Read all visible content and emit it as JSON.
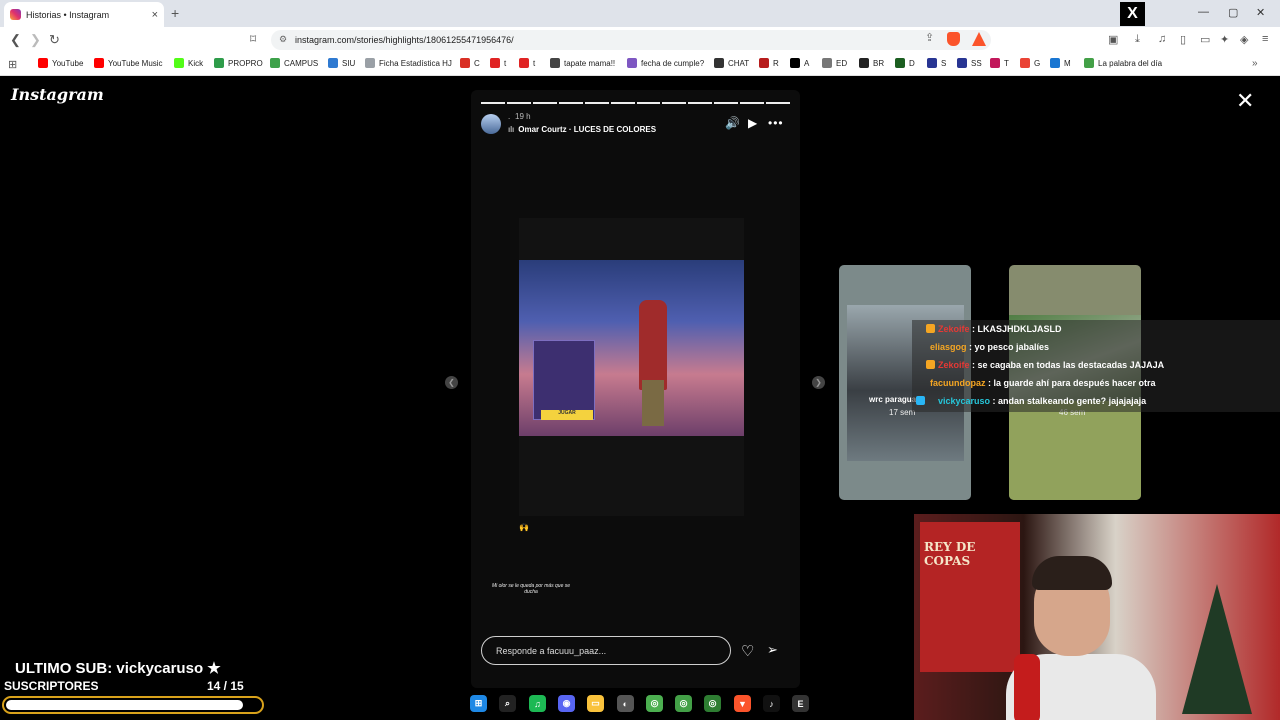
{
  "tab": {
    "title": "Historias • Instagram",
    "close": "×",
    "new_tab": "+"
  },
  "window": {
    "x_label": "X",
    "minimize": "—",
    "maximize": "▢",
    "close": "✕"
  },
  "toolbar": {
    "url": "instagram.com/stories/highlights/18061255471956476/",
    "back": "❮",
    "forward": "❯",
    "reload": "↻",
    "bookmark": "⌑"
  },
  "bookmarks": [
    {
      "label": "YouTube",
      "color": "#ff0000"
    },
    {
      "label": "YouTube Music",
      "color": "#ff0000"
    },
    {
      "label": "Kick",
      "color": "#53fc18"
    },
    {
      "label": "PROPRO",
      "color": "#2e9c4a"
    },
    {
      "label": "CAMPUS",
      "color": "#3da14a"
    },
    {
      "label": "SIU",
      "color": "#2f7ad1"
    },
    {
      "label": "Ficha Estadística HJ",
      "color": "#9aa0a6"
    },
    {
      "label": "C",
      "color": "#d93025"
    },
    {
      "label": "t",
      "color": "#e02424"
    },
    {
      "label": "t",
      "color": "#e02424"
    },
    {
      "label": "tapate mama!!",
      "color": "#444444"
    },
    {
      "label": "fecha de cumple?",
      "color": "#7e57c2"
    },
    {
      "label": "CHAT",
      "color": "#333333"
    },
    {
      "label": "R",
      "color": "#b71c1c"
    },
    {
      "label": "A",
      "color": "#000000"
    },
    {
      "label": "ED",
      "color": "#777777"
    },
    {
      "label": "BR",
      "color": "#222222"
    },
    {
      "label": "D",
      "color": "#1b5e20"
    },
    {
      "label": "S",
      "color": "#283593"
    },
    {
      "label": "SS",
      "color": "#283593"
    },
    {
      "label": "T",
      "color": "#c2185b"
    },
    {
      "label": "G",
      "color": "#ea4335"
    },
    {
      "label": "M",
      "color": "#1976d2"
    },
    {
      "label": "La palabra del día",
      "color": "#43a047"
    }
  ],
  "page": {
    "logo": "Instagram",
    "close": "✕",
    "story": {
      "dot": ".",
      "time": "19 h",
      "audio": "Omar Courtz · LUCES DE COLORES",
      "caption": "Mi olor se le queda por más que se ducha",
      "emoji": "🙌",
      "reply_placeholder": "Responde a facuuu_paaz...",
      "tv_play": "JUGAR"
    },
    "thumbs": [
      {
        "name": "wrc paraguay",
        "time": "17 sem"
      },
      {
        "name": "",
        "time": "46 sem"
      }
    ]
  },
  "chat": [
    {
      "user": "Zekoife",
      "text": " : LKASJHDKLJASLD",
      "color": "#e53935",
      "badge": "#f5a623"
    },
    {
      "user": "eliasgog",
      "text": " : yo pesco jabalíes",
      "color": "#f5a623",
      "badge": ""
    },
    {
      "user": "Zekoife",
      "text": " : se cagaba en todas las destacadas JAJAJA",
      "color": "#e53935",
      "badge": "#f5a623"
    },
    {
      "user": "facuundopaz",
      "text": " : la guarde ahí para después hacer otra",
      "color": "#f5a623",
      "badge": ""
    },
    {
      "user": "vickycaruso",
      "text": " : andan stalkeando gente? jajajajaja",
      "color": "#26c6da",
      "badge": "#29b6f6"
    }
  ],
  "webcam": {
    "flag_text": "REY DE COPAS"
  },
  "subs": {
    "last_sub": "ULTIMO SUB: vickycaruso ★",
    "label": "SUSCRIPTORES",
    "count": "14  / 15",
    "progress": 0.933
  },
  "taskbar": [
    {
      "name": "windows-start-icon",
      "color": "#1e88e5",
      "glyph": "⊞"
    },
    {
      "name": "search-icon",
      "color": "#222222",
      "glyph": "⌕"
    },
    {
      "name": "spotify-icon",
      "color": "#1db954",
      "glyph": "♫"
    },
    {
      "name": "discord-icon",
      "color": "#5865f2",
      "glyph": "◉"
    },
    {
      "name": "file-explorer-icon",
      "color": "#f9c23c",
      "glyph": "▭"
    },
    {
      "name": "app-icon",
      "color": "#555555",
      "glyph": "◐"
    },
    {
      "name": "chrome-icon",
      "color": "#4caf50",
      "glyph": "◎"
    },
    {
      "name": "chrome-profile-icon",
      "color": "#43a047",
      "glyph": "◎"
    },
    {
      "name": "chrome-profile-2-icon",
      "color": "#2e7d32",
      "glyph": "◎"
    },
    {
      "name": "brave-icon",
      "color": "#fb542b",
      "glyph": "▼"
    },
    {
      "name": "tiktok-icon",
      "color": "#111111",
      "glyph": "♪"
    },
    {
      "name": "epic-games-icon",
      "color": "#333333",
      "glyph": "E"
    }
  ]
}
